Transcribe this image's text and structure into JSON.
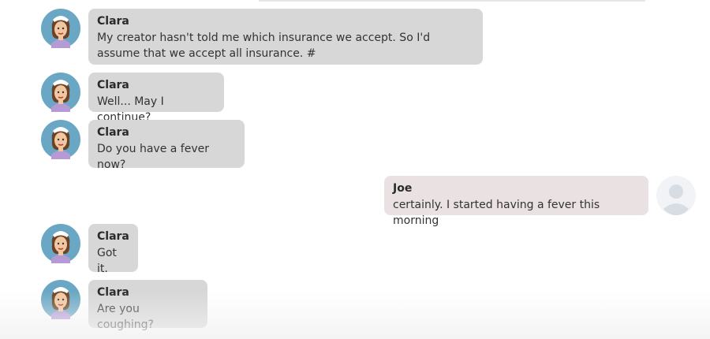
{
  "messages": [
    {
      "sender": "bot",
      "name": "Clara",
      "text": "My creator hasn't told me which insurance we accept. So I'd assume that we accept all insurance. #"
    },
    {
      "sender": "bot",
      "name": "Clara",
      "text": "Well... May I continue?"
    },
    {
      "sender": "bot",
      "name": "Clara",
      "text": "Do you have a fever now?"
    },
    {
      "sender": "user",
      "name": "Joe",
      "text": "certainly. I started having a fever this morning"
    },
    {
      "sender": "bot",
      "name": "Clara",
      "text": "Got it."
    },
    {
      "sender": "bot",
      "name": "Clara",
      "text": "Are you coughing?"
    }
  ],
  "colors": {
    "bot_bubble": "#d7d7d7",
    "user_bubble": "#eae2e2",
    "avatar_ring": "#6aa7c4"
  },
  "icons": {
    "bot_avatar": "nurse-avatar-icon",
    "user_avatar": "default-user-avatar-icon"
  }
}
